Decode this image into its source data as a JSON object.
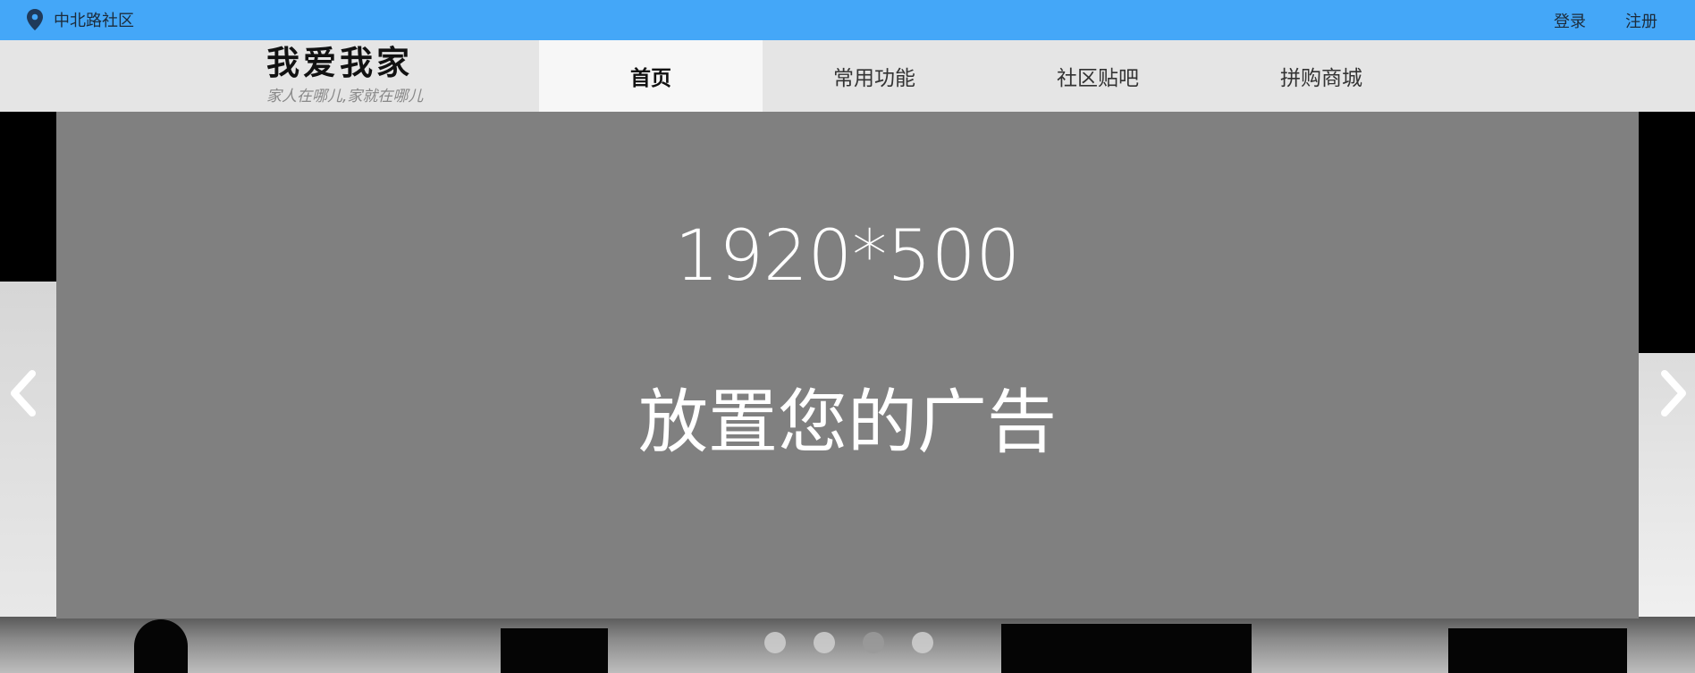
{
  "topbar": {
    "location_icon": "map-pin-icon",
    "community": "中北路社区",
    "login": "登录",
    "register": "注册",
    "color": "#44a7f8"
  },
  "header": {
    "logo_title": "我爱我家",
    "logo_subtitle": "家人在哪儿,家就在哪儿",
    "nav": [
      {
        "label": "首页",
        "active": true
      },
      {
        "label": "常用功能",
        "active": false
      },
      {
        "label": "社区贴吧",
        "active": false
      },
      {
        "label": "拼购商城",
        "active": false
      }
    ]
  },
  "banner": {
    "size_text": "1920*500",
    "ad_text": "放置您的广告",
    "prev_icon": "chevron-left-icon",
    "next_icon": "chevron-right-icon",
    "slides": 4,
    "current_slide": 3
  }
}
